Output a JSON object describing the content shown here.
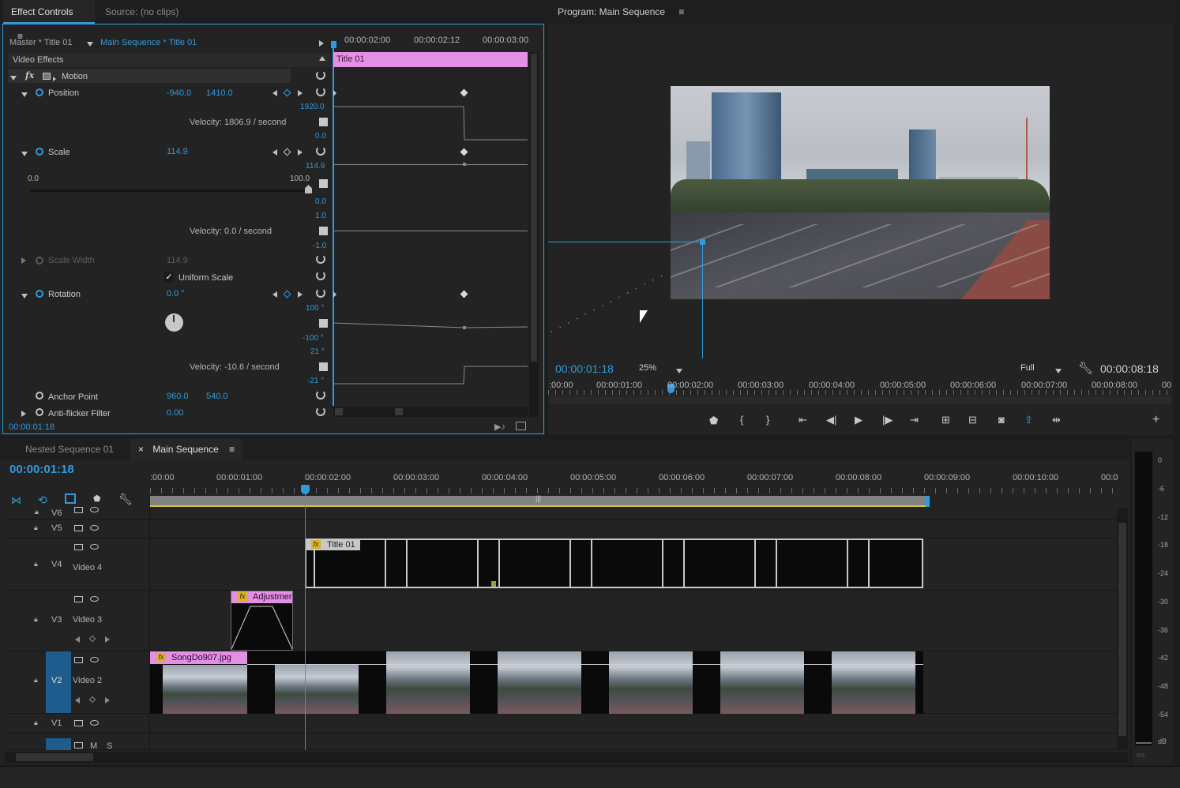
{
  "effect_controls": {
    "tab_label": "Effect Controls",
    "source_tab": "Source: (no clips)",
    "master_label": "Master * Title 01",
    "sequence_label": "Main Sequence * Title 01",
    "section": "Video Effects",
    "motion": "Motion",
    "position": {
      "label": "Position",
      "x": "-940.0",
      "y": "1410.0",
      "graph_max": "1920.0",
      "graph_min": "0.0",
      "velocity": "Velocity: 1806.9 / second"
    },
    "scale": {
      "label": "Scale",
      "value": "114.9",
      "graph_top": "114.9",
      "slider_min": "0.0",
      "slider_max": "100.0",
      "graph_mid": "0.0",
      "vel_max": "1.0",
      "vel_min": "-1.0",
      "velocity": "Velocity: 0.0 / second"
    },
    "scale_width": {
      "label": "Scale Width",
      "value": "114.9"
    },
    "uniform_scale": "Uniform Scale",
    "rotation": {
      "label": "Rotation",
      "value": "0.0 °",
      "graph_max": "100 °",
      "graph_min": "-100 °",
      "vel_max": "21 °",
      "vel_min": "-21 °",
      "velocity": "Velocity: -10.6 / second"
    },
    "anchor": {
      "label": "Anchor Point",
      "x": "960.0",
      "y": "540.0"
    },
    "antiflicker": {
      "label": "Anti-flicker Filter",
      "value": "0.00"
    },
    "timecode": "00:00:01:18",
    "ruler": [
      "00:00:02:00",
      "00:00:02:12",
      "00:00:03:00"
    ],
    "clip_label": "Title 01"
  },
  "program": {
    "title": "Program: Main Sequence",
    "timecode": "00:00:01:18",
    "zoom": "25%",
    "quality": "Full",
    "duration": "00:00:08:18",
    "ruler": [
      ":00:00",
      "00:00:01:00",
      "00:00:02:00",
      "00:00:03:00",
      "00:00:04:00",
      "00:00:05:00",
      "00:00:06:00",
      "00:00:07:00",
      "00:00:08:00",
      "00"
    ]
  },
  "timeline": {
    "tabs": [
      "Nested Sequence 01",
      "Main Sequence"
    ],
    "timecode": "00:00:01:18",
    "ruler": [
      ":00:00",
      "00:00:01:00",
      "00:00:02:00",
      "00:00:03:00",
      "00:00:04:00",
      "00:00:05:00",
      "00:00:06:00",
      "00:00:07:00",
      "00:00:08:00",
      "00:00:09:00",
      "00:00:10:00",
      "00:0"
    ],
    "tracks": {
      "v6": "V6",
      "v5": "V5",
      "v4": "V4",
      "v4_name": "Video 4",
      "v3": "V3",
      "v3_name": "Video 3",
      "v2": "V2",
      "v2_name": "Video 2",
      "v1": "V1",
      "a_label": "M",
      "s_label": "S"
    },
    "clips": {
      "title": "Title 01",
      "adjustment": "Adjustmer",
      "image": "SongDo907.jpg"
    }
  },
  "meter": [
    "0",
    "-6",
    "-12",
    "-18",
    "-24",
    "-30",
    "-36",
    "-42",
    "-48",
    "-54",
    "dB"
  ]
}
